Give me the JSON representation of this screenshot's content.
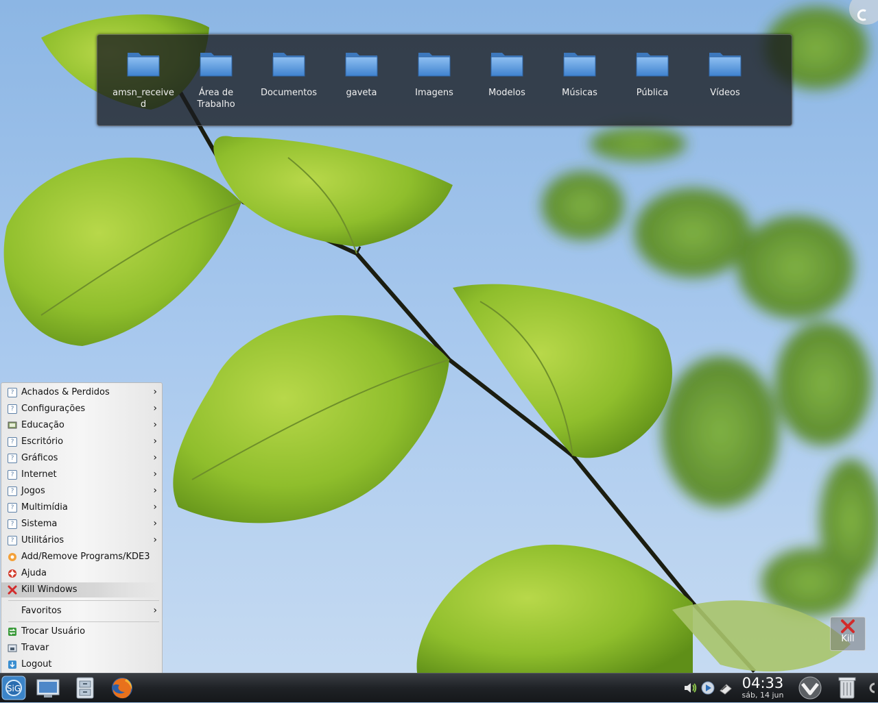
{
  "desktop": {
    "folders": [
      {
        "label": "amsn_received",
        "icon": "folder-icon"
      },
      {
        "label": "Área de Trabalho",
        "icon": "folder-icon"
      },
      {
        "label": "Documentos",
        "icon": "folder-icon"
      },
      {
        "label": "gaveta",
        "icon": "folder-icon"
      },
      {
        "label": "Imagens",
        "icon": "folder-icon"
      },
      {
        "label": "Modelos",
        "icon": "folder-icon"
      },
      {
        "label": "Músicas",
        "icon": "folder-icon"
      },
      {
        "label": "Pública",
        "icon": "folder-icon"
      },
      {
        "label": "Vídeos",
        "icon": "folder-icon"
      }
    ]
  },
  "menu": {
    "items": [
      {
        "label": "Achados & Perdidos",
        "icon": "unknown-icon",
        "submenu": true
      },
      {
        "label": "Configurações",
        "icon": "unknown-icon",
        "submenu": true
      },
      {
        "label": "Educação",
        "icon": "education-icon",
        "submenu": true
      },
      {
        "label": "Escritório",
        "icon": "unknown-icon",
        "submenu": true
      },
      {
        "label": "Gráficos",
        "icon": "unknown-icon",
        "submenu": true
      },
      {
        "label": "Internet",
        "icon": "unknown-icon",
        "submenu": true
      },
      {
        "label": "Jogos",
        "icon": "unknown-icon",
        "submenu": true
      },
      {
        "label": "Multimídia",
        "icon": "unknown-icon",
        "submenu": true
      },
      {
        "label": "Sistema",
        "icon": "unknown-icon",
        "submenu": true
      },
      {
        "label": "Utilitários",
        "icon": "unknown-icon",
        "submenu": true
      },
      {
        "label": "Add/Remove Programs/KDE3",
        "icon": "package-icon",
        "submenu": false
      },
      {
        "label": "Ajuda",
        "icon": "help-lifebuoy-icon",
        "submenu": false
      },
      {
        "label": "Kill Windows",
        "icon": "kill-icon",
        "submenu": false
      }
    ],
    "favorites": {
      "label": "Favoritos",
      "submenu": true
    },
    "session": [
      {
        "label": "Trocar Usuário",
        "icon": "switch-user-icon"
      },
      {
        "label": "Travar",
        "icon": "lock-icon"
      },
      {
        "label": "Logout",
        "icon": "logout-icon"
      }
    ],
    "highlighted": "Kill Windows"
  },
  "kill_applet": {
    "label": "Kill"
  },
  "panel": {
    "launchers": [
      "application-menu-icon",
      "show-desktop-icon",
      "file-manager-icon",
      "firefox-icon"
    ],
    "tray": [
      "volume-icon",
      "media-player-icon",
      "network-icon"
    ],
    "clock": {
      "time": "04:33",
      "date": "sáb, 14 jun"
    }
  },
  "colors": {
    "accent": "#4f8fd8",
    "folder": "#6aa6e6",
    "kill": "#d22b2b"
  }
}
